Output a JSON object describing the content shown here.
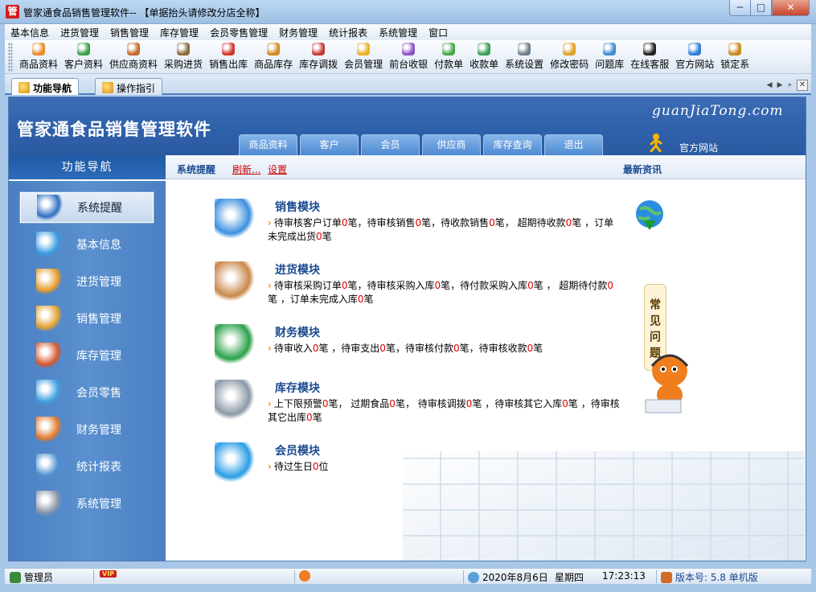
{
  "window": {
    "app_icon_char": "管",
    "title": "管家通食品销售管理软件-- 【单据抬头请修改分店全称】",
    "minimize": "─",
    "maximize": "□",
    "close": "✕"
  },
  "menu": [
    "基本信息",
    "进货管理",
    "销售管理",
    "库存管理",
    "会员零售管理",
    "财务管理",
    "统计报表",
    "系统管理",
    "窗口"
  ],
  "toolbar": [
    {
      "label": "商品资料",
      "icon": "products-icon",
      "color": "#e98a2b"
    },
    {
      "label": "客户资料",
      "icon": "customers-icon",
      "color": "#3aa04a"
    },
    {
      "label": "供应商资料",
      "icon": "suppliers-icon",
      "color": "#c7692f"
    },
    {
      "label": "采购进货",
      "icon": "purchase-icon",
      "color": "#8a6b3c"
    },
    {
      "label": "销售出库",
      "icon": "sales-out-icon",
      "color": "#d2352c"
    },
    {
      "label": "商品库存",
      "icon": "inventory-icon",
      "color": "#d28b22"
    },
    {
      "label": "库存调拨",
      "icon": "transfer-icon",
      "color": "#c73a33"
    },
    {
      "label": "会员管理",
      "icon": "member-icon",
      "color": "#e7b225"
    },
    {
      "label": "前台收银",
      "icon": "cashier-icon",
      "color": "#8c55c4"
    },
    {
      "label": "付款单",
      "icon": "payment-icon",
      "color": "#4aa64a"
    },
    {
      "label": "收款单",
      "icon": "receipt-icon",
      "color": "#3b9d5a"
    },
    {
      "label": "系统设置",
      "icon": "settings-icon",
      "color": "#6e7d8c"
    },
    {
      "label": "修改密码",
      "icon": "password-icon",
      "color": "#e0a12a"
    },
    {
      "label": "问题库",
      "icon": "faq-icon",
      "color": "#3f8ad1"
    },
    {
      "label": "在线客服",
      "icon": "qq-icon",
      "color": "#222222"
    },
    {
      "label": "官方网站",
      "icon": "ie-icon",
      "color": "#2f7fd6"
    },
    {
      "label": "锁定系",
      "icon": "lock-icon",
      "color": "#c98a22"
    }
  ],
  "tabs": {
    "nav": "功能导航",
    "guide": "操作指引"
  },
  "banner": {
    "title": "管家通食品销售管理软件",
    "site": "guanJiaTong.com",
    "tabs": [
      "商品资料",
      "客户",
      "会员",
      "供应商",
      "库存查询",
      "退出"
    ],
    "official": "官方网站"
  },
  "sidebar": {
    "header": "功能导航",
    "items": [
      {
        "label": "系统提醒",
        "icon": "info-icon",
        "active": true
      },
      {
        "label": "基本信息",
        "icon": "cubes-icon"
      },
      {
        "label": "进货管理",
        "icon": "box-in-icon"
      },
      {
        "label": "销售管理",
        "icon": "box-out-icon"
      },
      {
        "label": "库存管理",
        "icon": "house-icon"
      },
      {
        "label": "会员零售",
        "icon": "chat-bubble-icon"
      },
      {
        "label": "财务管理",
        "icon": "finance-icon"
      },
      {
        "label": "统计报表",
        "icon": "chart-icon"
      },
      {
        "label": "系统管理",
        "icon": "gears-icon"
      }
    ]
  },
  "content": {
    "remind": "系统提醒",
    "refresh": "刷新...",
    "settings": "设置",
    "news": "最新资讯",
    "faq": "常见问题"
  },
  "modules": [
    {
      "title": "销售模块",
      "icon": "folder-icon",
      "parts": [
        "待审核客户订单",
        "0",
        "笔，待审核销售",
        "0",
        "笔，待收款销售",
        "0",
        "笔， 超期待收款",
        "0",
        "笔 ，订单未完成出货",
        "0",
        "笔"
      ]
    },
    {
      "title": "进货模块",
      "icon": "box-icon",
      "parts": [
        "待审核采购订单",
        "0",
        "笔，待审核采购入库",
        "0",
        "笔，待付款采购入库",
        "0",
        "笔 ， 超期待付款",
        "0",
        "笔 ，订单未完成入库",
        "0",
        "笔"
      ]
    },
    {
      "title": "财务模块",
      "icon": "dollar-icon",
      "parts": [
        "待审收入",
        "0",
        "笔 ，待审支出",
        "0",
        "笔，待审核付款",
        "0",
        "笔，待审核收款",
        "0",
        "笔"
      ]
    },
    {
      "title": "库存模块",
      "icon": "database-icon",
      "parts": [
        "上下限预警",
        "0",
        "笔，  过期食品",
        "0",
        "笔，  待审核调拨",
        "0",
        "笔 ，待审核其它入库",
        "0",
        "笔 ，待审核其它出库",
        "0",
        "笔"
      ]
    },
    {
      "title": "会员模块",
      "icon": "members-icon",
      "parts": [
        "待过生日",
        "0",
        "位"
      ]
    }
  ],
  "status": {
    "user": "管理员",
    "vip": "VIP",
    "date": "2020年8月6日",
    "weekday": "星期四",
    "time": "17:23:13",
    "version": "版本号: 5.8 单机版"
  }
}
